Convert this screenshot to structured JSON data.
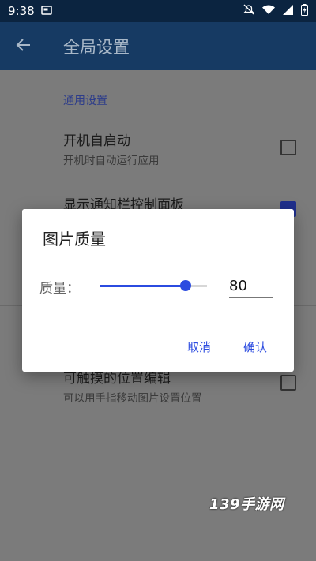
{
  "status_bar": {
    "time": "9:38",
    "icons": [
      "screenshot-icon",
      "mute-icon",
      "wifi-icon",
      "signal-icon",
      "battery-icon"
    ]
  },
  "toolbar": {
    "back_icon": "arrow-left-icon",
    "title": "全局设置"
  },
  "settings": {
    "section_general": "通用设置",
    "items": [
      {
        "title": "开机自启动",
        "subtitle": "开机时自动运行应用",
        "checked": false
      },
      {
        "title": "显示通知栏控制面板",
        "checked": true
      },
      {
        "title": "可触摸的位置编辑",
        "subtitle": "可以用手指移动图片设置位置",
        "checked": false
      }
    ]
  },
  "dialog": {
    "title": "图片质量",
    "quality_label": "质量：",
    "quality_value": "80",
    "slider_fraction": 0.8,
    "cancel": "取消",
    "confirm": "确认"
  },
  "watermark": "139手游网",
  "colors": {
    "accent": "#2b4be0",
    "toolbar": "#163a63",
    "status_bar": "#0b2440"
  }
}
